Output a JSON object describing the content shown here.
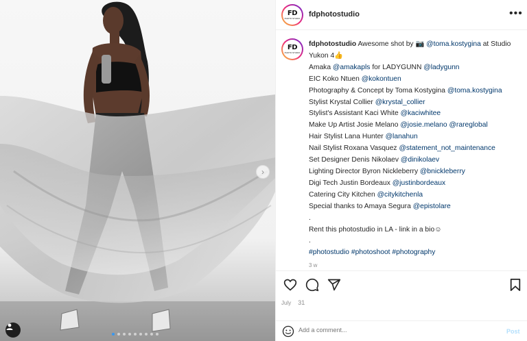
{
  "account": {
    "username": "fdphotostudio",
    "avatar_logo_big": "FD",
    "avatar_logo_small": "PHOTO STUDIO"
  },
  "header": {
    "more_label": "•••"
  },
  "caption": {
    "owner": "fdphotostudio",
    "line1_prefix": " Awesome shot by 📷 ",
    "line1_mention": "@toma.kostygina",
    "line1_suffix": " at Studio Yukon 4👍",
    "lines": [
      {
        "text": "Amaka ",
        "mention": "@amakapls",
        "after": " for LADYGUNN ",
        "mention2": "@ladygunn"
      },
      {
        "text": "EIC Koko Ntuen ",
        "mention": "@kokontuen",
        "after": "",
        "mention2": ""
      },
      {
        "text": "Photography & Concept by Toma Kostygina ",
        "mention": "@toma.kostygina",
        "after": "",
        "mention2": ""
      },
      {
        "text": "Stylist Krystal Collier ",
        "mention": "@krystal_collier",
        "after": "",
        "mention2": ""
      },
      {
        "text": "Stylist's Assistant Kaci White ",
        "mention": "@kaciwhitee",
        "after": "",
        "mention2": ""
      },
      {
        "text": "Make Up Artist Josie Melano ",
        "mention": "@josie.melano",
        "after": " ",
        "mention2": "@rareglobal"
      },
      {
        "text": "Hair Stylist Lana Hunter ",
        "mention": "@lanahun",
        "after": "",
        "mention2": ""
      },
      {
        "text": "Nail Stylist Roxana Vasquez ",
        "mention": "@statement_not_maintenance",
        "after": "",
        "mention2": ""
      },
      {
        "text": "Set Designer Denis Nikolaev ",
        "mention": "@dinikolaev",
        "after": "",
        "mention2": ""
      },
      {
        "text": "Lighting Director Byron Nickleberry ",
        "mention": "@bnickleberry",
        "after": "",
        "mention2": ""
      },
      {
        "text": "Digi Tech Justin Bordeaux ",
        "mention": "@justinbordeaux",
        "after": "",
        "mention2": ""
      },
      {
        "text": "Catering City Kitchen ",
        "mention": "@citykitchenla",
        "after": "",
        "mention2": ""
      },
      {
        "text": "Special thanks to Amaya Segura ",
        "mention": "@epistolare",
        "after": "",
        "mention2": ""
      }
    ],
    "dot1": ".",
    "rent_line": "Rent this photostudio in LA - link in a bio☺",
    "dot2": ".",
    "hashtags": [
      "#photostudio",
      "#photoshoot",
      "#photography"
    ],
    "time_ago": "3 w"
  },
  "actions": {
    "like_icon": "heart-icon",
    "comment_icon": "comment-icon",
    "share_icon": "share-icon",
    "save_icon": "bookmark-icon"
  },
  "date": {
    "month": "July",
    "day": "31"
  },
  "comment": {
    "placeholder": "Add a comment...",
    "post_label": "Post"
  },
  "carousel": {
    "slide_count": 9,
    "active_index": 0
  },
  "colors": {
    "link": "#00376b",
    "carousel_active": "#3897f0",
    "post_disabled": "#b2dffc",
    "muted": "#8e8e8e"
  }
}
